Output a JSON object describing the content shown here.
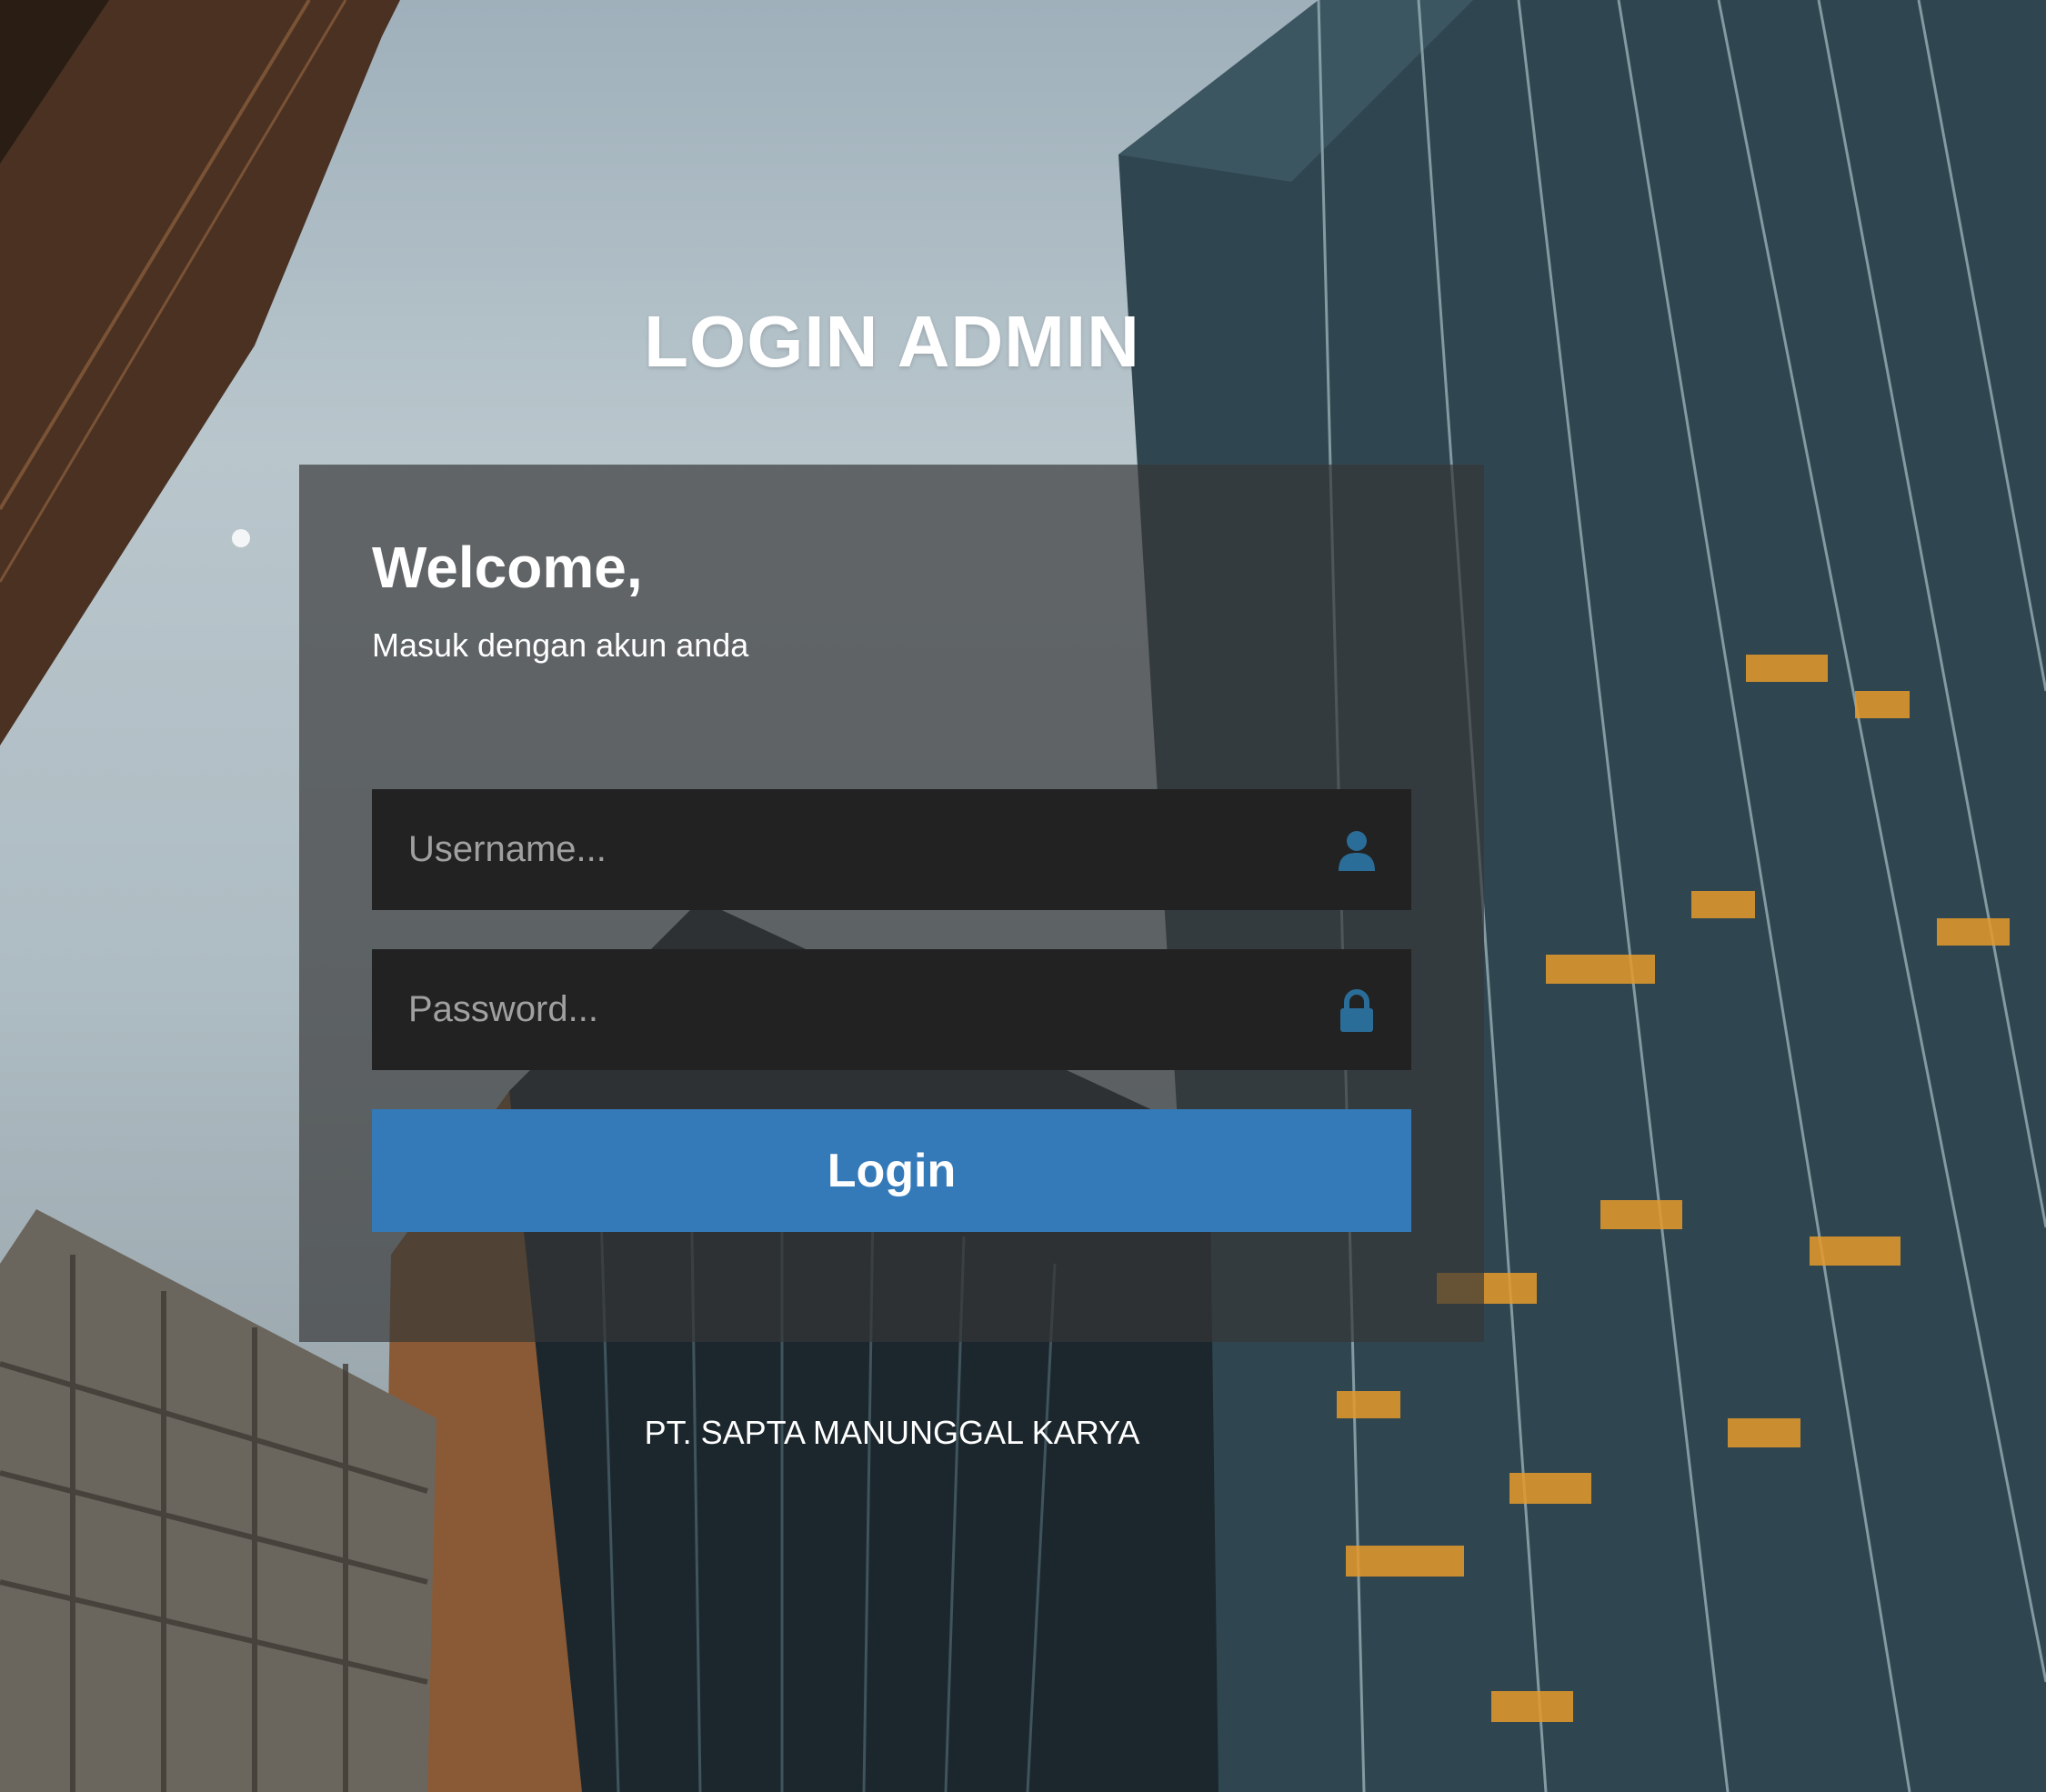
{
  "page": {
    "title": "LOGIN ADMIN",
    "company": "PT. SAPTA MANUNGGAL KARYA"
  },
  "login_panel": {
    "heading": "Welcome,",
    "subheading": "Masuk dengan akun anda",
    "username": {
      "placeholder": "Username...",
      "value": "",
      "icon": "user-icon"
    },
    "password": {
      "placeholder": "Password...",
      "value": "",
      "icon": "lock-icon"
    },
    "submit_label": "Login"
  },
  "colors": {
    "primary_button": "#347ab8",
    "icon": "#2b6d99",
    "input_bg": "#222222",
    "panel_bg": "rgba(55,55,55,0.68)"
  }
}
